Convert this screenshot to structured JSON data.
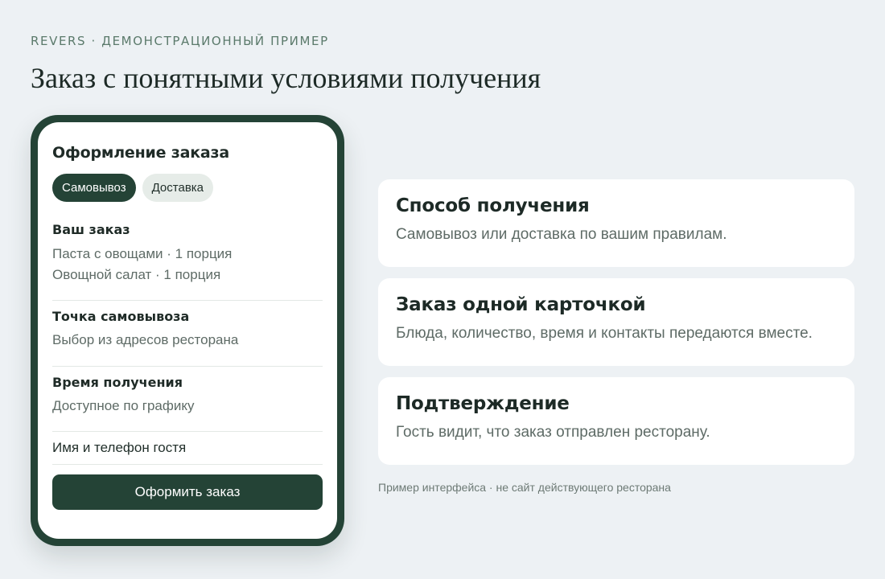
{
  "header": {
    "eyebrow": "REVERS · ДЕМОНСТРАЦИОННЫЙ ПРИМЕР",
    "title": "Заказ с понятными условиями получения"
  },
  "phone": {
    "screen_title": "Оформление заказа",
    "tabs": [
      {
        "label": "Самовывоз",
        "active": true
      },
      {
        "label": "Доставка",
        "active": false
      }
    ],
    "order": {
      "heading": "Ваш заказ",
      "items": [
        "Паста с овощами · 1 порция",
        "Овощной салат · 1 порция"
      ]
    },
    "pickup_point": {
      "heading": "Точка самовывоза",
      "text": "Выбор из адресов ресторана"
    },
    "pickup_time": {
      "heading": "Время получения",
      "text": "Доступное по графику"
    },
    "guest_field": "Имя и телефон гостя",
    "submit_label": "Оформить заказ"
  },
  "cards": [
    {
      "title": "Способ получения",
      "text": "Самовывоз или доставка по вашим правилам."
    },
    {
      "title": "Заказ одной карточкой",
      "text": "Блюда, количество, время и контакты передаются вместе."
    },
    {
      "title": "Подтверждение",
      "text": "Гость видит, что заказ отправлен ресторану."
    }
  ],
  "footnote": "Пример интерфейса · не сайт действующего ресторана",
  "colors": {
    "background": "#edf1f4",
    "accent": "#244336",
    "muted_pill": "#e6ece8"
  }
}
